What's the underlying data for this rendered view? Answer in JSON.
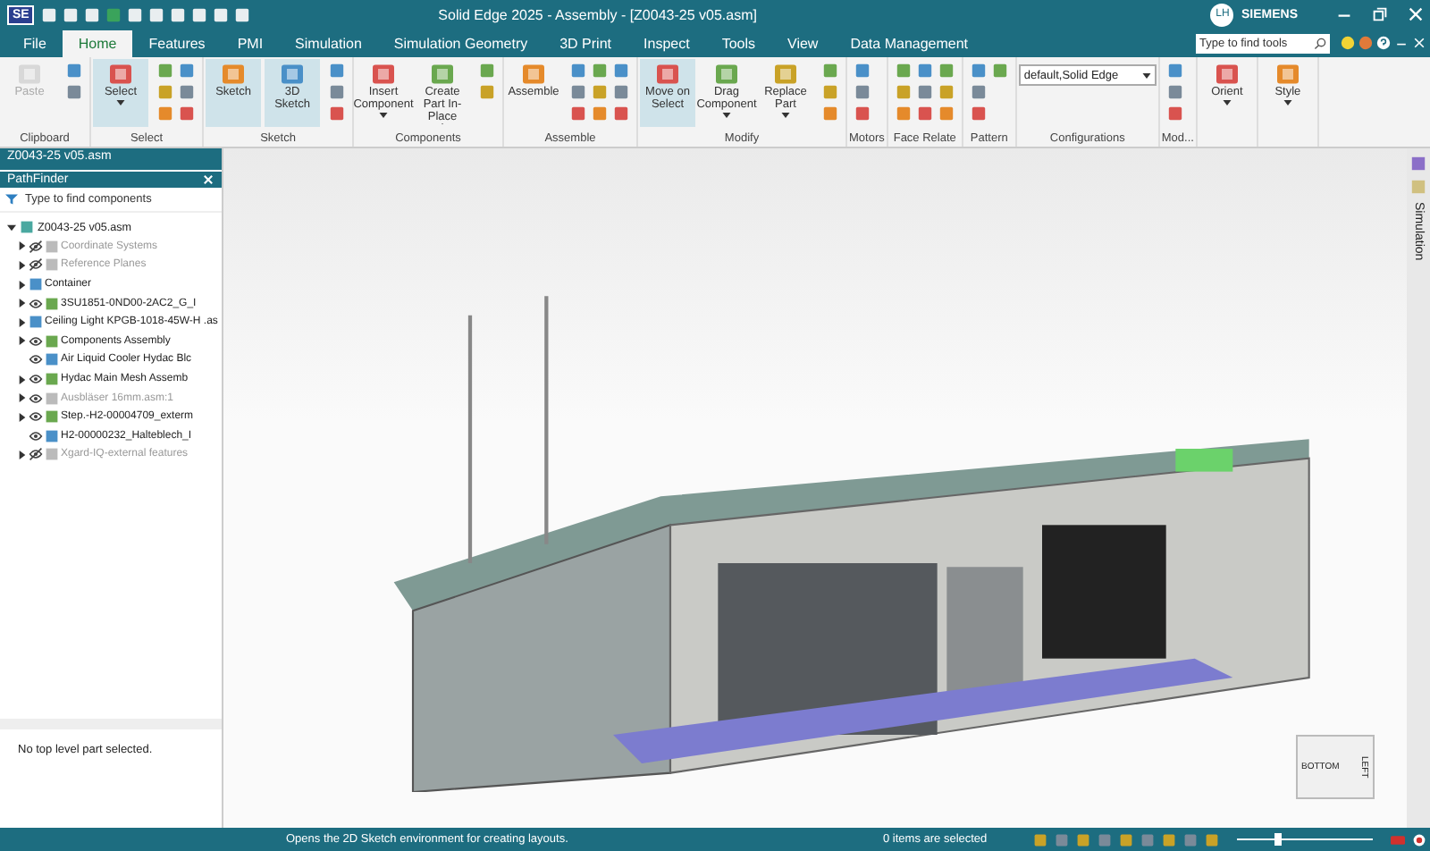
{
  "window": {
    "title": "Solid Edge 2025 - Assembly - [Z0043-25 v05.asm]",
    "app_badge": "SE",
    "user_initials": "LH",
    "brand": "SIEMENS"
  },
  "menu_tabs": [
    {
      "label": "File",
      "selected": false
    },
    {
      "label": "Home",
      "selected": true
    },
    {
      "label": "Features",
      "selected": false
    },
    {
      "label": "PMI",
      "selected": false
    },
    {
      "label": "Simulation",
      "selected": false
    },
    {
      "label": "Simulation Geometry",
      "selected": false
    },
    {
      "label": "3D Print",
      "selected": false
    },
    {
      "label": "Inspect",
      "selected": false
    },
    {
      "label": "Tools",
      "selected": false
    },
    {
      "label": "View",
      "selected": false
    },
    {
      "label": "Data Management",
      "selected": false
    }
  ],
  "tool_search": {
    "placeholder": "Type to find tools"
  },
  "ribbon": [
    {
      "label": "Clipboard",
      "buttons": [
        {
          "label": "Paste",
          "dropdown": false,
          "selected": false,
          "disabled": true
        }
      ]
    },
    {
      "label": "Select",
      "buttons": [
        {
          "label": "Select",
          "dropdown": true,
          "selected": true,
          "disabled": false
        }
      ]
    },
    {
      "label": "Sketch",
      "buttons": [
        {
          "label": "Sketch",
          "dropdown": false,
          "selected": true,
          "disabled": false
        },
        {
          "label": "3D Sketch",
          "dropdown": false,
          "selected": true,
          "disabled": false
        }
      ]
    },
    {
      "label": "Components",
      "buttons": [
        {
          "label": "Insert Component",
          "dropdown": true,
          "selected": false,
          "disabled": false
        },
        {
          "label": "Create Part In-Place",
          "dropdown": true,
          "selected": false,
          "disabled": false
        }
      ]
    },
    {
      "label": "Assemble",
      "buttons": [
        {
          "label": "Assemble",
          "dropdown": false,
          "selected": false,
          "disabled": false
        }
      ]
    },
    {
      "label": "Modify",
      "buttons": [
        {
          "label": "Move on Select",
          "dropdown": false,
          "selected": true,
          "disabled": false
        },
        {
          "label": "Drag Component",
          "dropdown": true,
          "selected": false,
          "disabled": false
        },
        {
          "label": "Replace Part",
          "dropdown": true,
          "selected": false,
          "disabled": false
        }
      ]
    },
    {
      "label": "Motors"
    },
    {
      "label": "Face Relate"
    },
    {
      "label": "Pattern"
    },
    {
      "label": "Configurations",
      "dropdown_value": "default,Solid Edge"
    },
    {
      "label": "Mod..."
    },
    {
      "buttons": [
        {
          "label": "Orient",
          "dropdown": true,
          "selected": false,
          "disabled": false
        }
      ]
    },
    {
      "buttons": [
        {
          "label": "Style",
          "dropdown": true,
          "selected": false,
          "disabled": false
        }
      ]
    }
  ],
  "document_tab": {
    "label": "Z0043-25 v05.asm"
  },
  "pathfinder": {
    "title": "PathFinder",
    "search_placeholder": "Type to find components",
    "root": {
      "name": "Z0043-25 v05.asm",
      "expanded": true,
      "children": [
        {
          "name": "Coordinate Systems",
          "kind": "branch",
          "expanded": false,
          "visible": false,
          "disabled": true
        },
        {
          "name": "Reference Planes",
          "kind": "branch",
          "expanded": false,
          "visible": false,
          "disabled": true
        },
        {
          "name": "Container",
          "kind": "branch",
          "expanded": false,
          "disabled": false
        },
        {
          "name": "3SU1851-0ND00-2AC2_G_I",
          "kind": "branch",
          "expanded": false,
          "visible": true,
          "disabled": false
        },
        {
          "name": "Ceiling Light KPGB-1018-45W-H .as",
          "kind": "branch",
          "expanded": false,
          "disabled": false
        },
        {
          "name": "Components Assembly",
          "kind": "branch",
          "expanded": false,
          "visible": true,
          "disabled": false
        },
        {
          "name": "Air Liquid Cooler Hydac Blc",
          "kind": "leaf",
          "visible": true,
          "disabled": false
        },
        {
          "name": "Hydac Main Mesh Assemb",
          "kind": "branch",
          "expanded": false,
          "visible": true,
          "disabled": false
        },
        {
          "name": "Ausbläser 16mm.asm:1",
          "kind": "branch",
          "expanded": false,
          "visible": true,
          "disabled": true
        },
        {
          "name": "Step.-H2-00004709_exterm",
          "kind": "branch",
          "expanded": false,
          "visible": true,
          "disabled": false
        },
        {
          "name": "H2-00000232_Halteblech_I",
          "kind": "leaf",
          "visible": true,
          "disabled": false
        },
        {
          "name": "Xgard-IQ-external features",
          "kind": "branch",
          "expanded": false,
          "visible": false,
          "disabled": true
        }
      ]
    },
    "details": "No top level part selected."
  },
  "side_tabs": [
    {
      "label": "Simulation"
    }
  ],
  "view_cube": {
    "faces": [
      "BOTTOM",
      "LEFT"
    ]
  },
  "status_bar": {
    "prompt": "Opens the 2D Sketch environment for creating layouts.",
    "selection": "0 items are selected",
    "zoom": {
      "level": 0.3
    }
  }
}
